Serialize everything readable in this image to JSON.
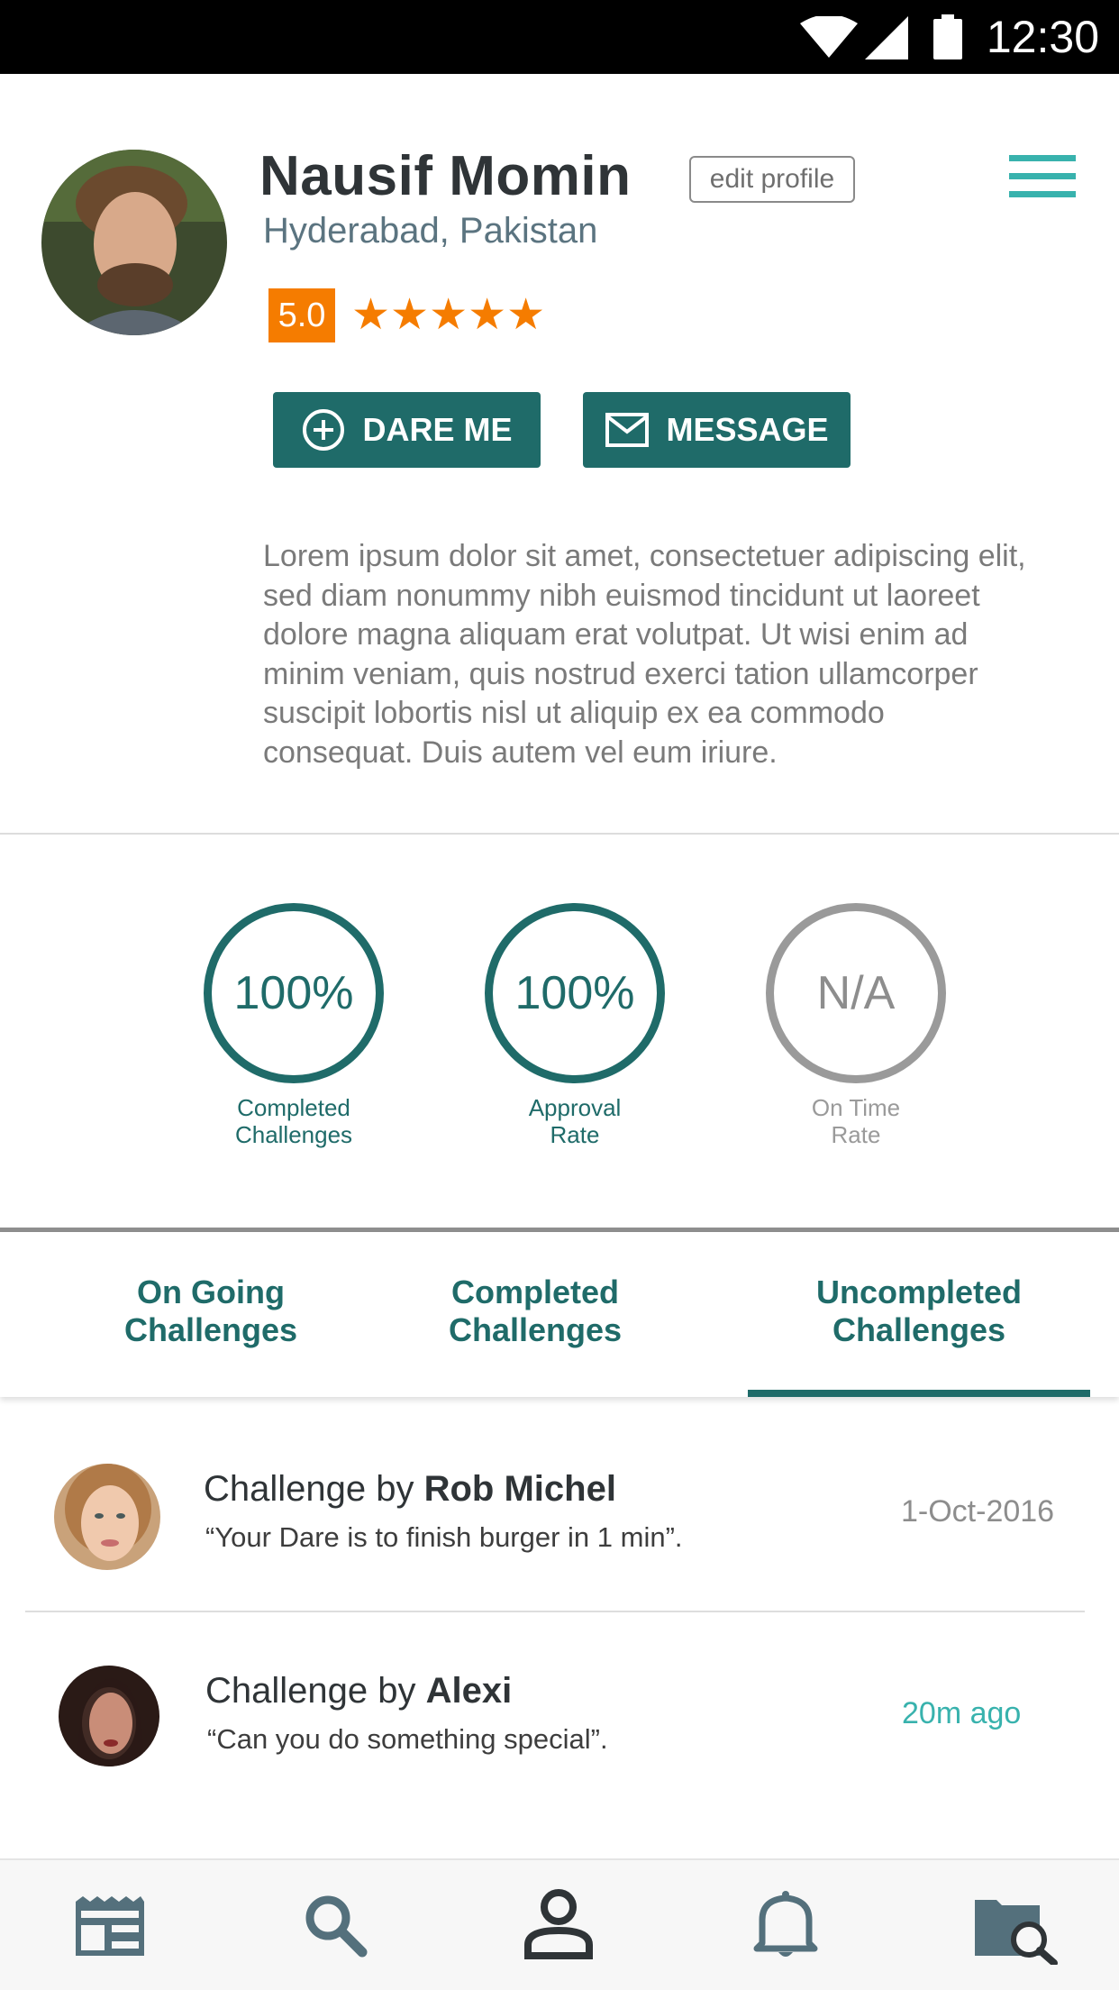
{
  "status_bar": {
    "time": "12:30",
    "icons": [
      "wifi-icon",
      "signal-icon",
      "battery-icon"
    ]
  },
  "profile": {
    "name": "Nausif Momin",
    "location": "Hyderabad, Pakistan",
    "edit_label": "edit profile",
    "rating": "5.0",
    "stars": "★★★★★",
    "star_count": 5,
    "dare_label": "DARE ME",
    "message_label": "MESSAGE",
    "bio": "Lorem ipsum dolor sit amet, consectetuer adipiscing elit, sed diam nonummy nibh euismod tincidunt ut laoreet dolore magna aliquam erat volutpat. Ut wisi enim ad minim veniam, quis nostrud exerci tation ullamcorper suscipit lobortis nisl ut aliquip ex ea commodo consequat. Duis autem vel eum iriure."
  },
  "stats": [
    {
      "value": "100%",
      "label_line1": "Completed",
      "label_line2": "Challenges"
    },
    {
      "value": "100%",
      "label_line1": "Approval",
      "label_line2": "Rate"
    },
    {
      "value": "N/A",
      "label_line1": "On Time",
      "label_line2": "Rate"
    }
  ],
  "tabs": [
    {
      "line1": "On Going",
      "line2": "Challenges",
      "active": false
    },
    {
      "line1": "Completed",
      "line2": "Challenges",
      "active": false
    },
    {
      "line1": "Uncompleted",
      "line2": "Challenges",
      "active": true
    }
  ],
  "challenges": [
    {
      "prefix": "Challenge by ",
      "author": "Rob Michel",
      "quote": "“Your Dare is to finish burger in 1 min”.",
      "date": "1-Oct-2016"
    },
    {
      "prefix": "Challenge by ",
      "author": "Alexi",
      "quote": "“Can you do something special”.",
      "date": "20m ago"
    }
  ],
  "bottom_nav": [
    "feed-icon",
    "search-icon",
    "profile-icon",
    "bell-icon",
    "folder-search-icon"
  ],
  "colors": {
    "accent": "#1f6b69",
    "highlight": "#38b2ad",
    "rating": "#f57c00"
  }
}
